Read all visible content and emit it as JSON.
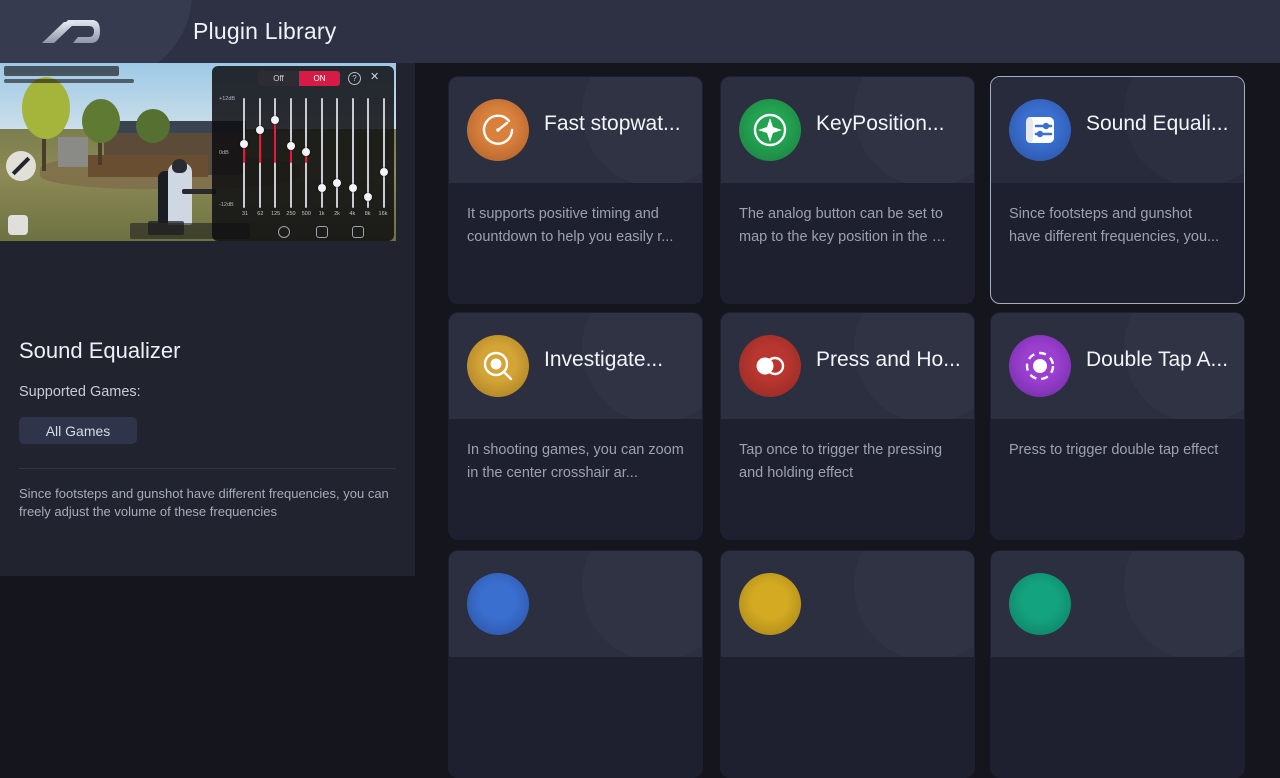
{
  "header": {
    "title": "Plugin Library",
    "logo_icon": "brand-d-logo"
  },
  "sidebar": {
    "preview": {
      "label": "game-screenshot-preview",
      "equalizer": {
        "off_label": "Off",
        "on_label": "ON",
        "help_icon": "?",
        "close_icon": "✕",
        "scale_labels": [
          "+12dB",
          "0dB",
          "-12dB"
        ],
        "bands": [
          "31",
          "62",
          "125",
          "250",
          "500",
          "1k",
          "2k",
          "4k",
          "8k",
          "16k"
        ],
        "band_values": [
          62,
          75,
          84,
          60,
          55,
          22,
          26,
          22,
          14,
          36
        ]
      }
    },
    "detail_title": "Sound Equalizer",
    "supported_label": "Supported Games:",
    "tag": "All Games",
    "description": "Since footsteps and gunshot have different frequencies, you can freely adjust the volume of these frequencies"
  },
  "grid": {
    "cards": [
      {
        "title": "Fast stopwat...",
        "description": "It supports positive timing and countdown to help you easily r...",
        "icon": "stopwatch-icon",
        "color_outer": "#a65c2a",
        "color_inner": "#d9803c",
        "selected": false
      },
      {
        "title": "KeyPosition...",
        "description": "The analog button can be set to map to the key position in the …",
        "icon": "key-position-compass-icon",
        "color_outer": "#1c7a3d",
        "color_inner": "#23a352",
        "selected": false
      },
      {
        "title": "Sound Equali...",
        "description": "Since footsteps and gunshot have different frequencies, you...",
        "icon": "sound-equalizer-icon",
        "color_outer": "#2a4f9e",
        "color_inner": "#3a6fd0",
        "selected": true
      },
      {
        "title": "Investigate...",
        "description": "In shooting games, you can zoom in the center crosshair ar...",
        "icon": "magnifier-investigate-icon",
        "color_outer": "#a07820",
        "color_inner": "#d4a436",
        "selected": false
      },
      {
        "title": "Press and Ho...",
        "description": "Tap once to trigger the pressing and holding effect",
        "icon": "press-and-hold-icon",
        "color_outer": "#8e2824",
        "color_inner": "#b8362f",
        "selected": false
      },
      {
        "title": "Double Tap A...",
        "description": "Press to trigger double tap effect",
        "icon": "double-tap-icon",
        "color_outer": "#6d2a9e",
        "color_inner": "#9a3fd0",
        "selected": false
      }
    ],
    "partial_row": [
      {
        "icon": "partial-card-icon-blue",
        "color_outer": "#2a4f9e",
        "color_inner": "#3a6fd0"
      },
      {
        "icon": "partial-card-icon-yellow",
        "color_outer": "#a08016",
        "color_inner": "#d4aa22"
      },
      {
        "icon": "partial-card-icon-teal",
        "color_outer": "#0e7a60",
        "color_inner": "#14a37f"
      }
    ]
  }
}
